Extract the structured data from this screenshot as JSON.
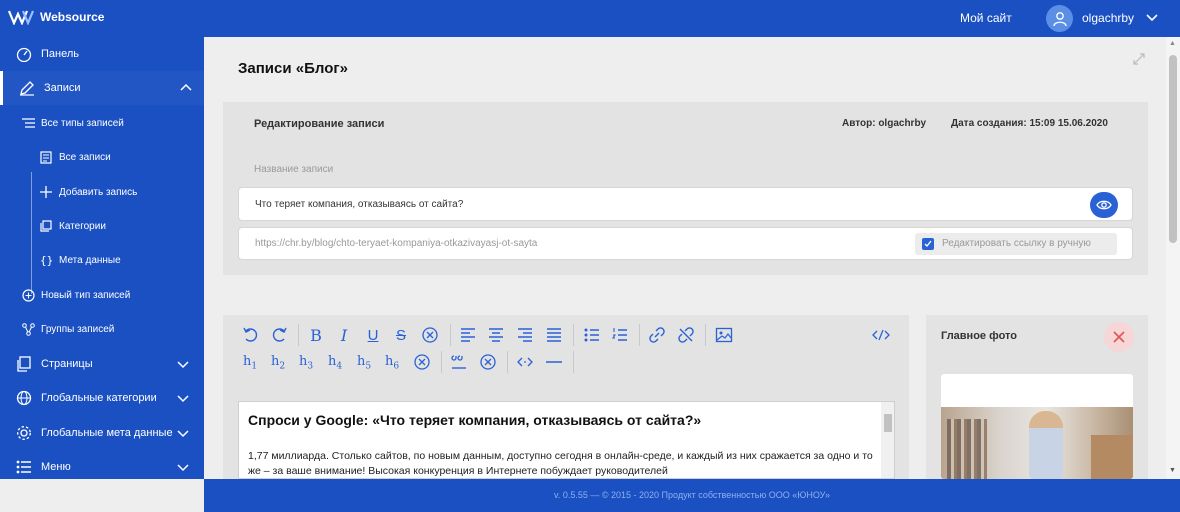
{
  "app": {
    "logo_text": "Websource",
    "brand_color": "#1a50c2",
    "accent_color": "#2a62d6"
  },
  "header": {
    "my_site": "Мой сайт",
    "username": "olgachrby"
  },
  "sidebar": {
    "items": [
      {
        "label": "Панель",
        "icon": "dashboard-icon"
      },
      {
        "label": "Записи",
        "icon": "pen-icon",
        "expanded": true
      },
      {
        "label": "Страницы",
        "icon": "pages-icon"
      },
      {
        "label": "Глобальные категории",
        "icon": "globe-icon"
      },
      {
        "label": "Глобальные мета данные",
        "icon": "gear-icon"
      },
      {
        "label": "Меню",
        "icon": "menu-icon"
      }
    ],
    "sub_items": [
      {
        "label": "Все типы записей",
        "icon": "list-icon"
      },
      {
        "label": "Все записи",
        "icon": "document-icon"
      },
      {
        "label": "Добавить запись",
        "icon": "plus-icon"
      },
      {
        "label": "Категории",
        "icon": "categories-icon"
      },
      {
        "label": "Мета данные",
        "icon": "braces-icon"
      },
      {
        "label": "Новый тип записей",
        "icon": "new-type-icon"
      },
      {
        "label": "Группы записей",
        "icon": "groups-icon"
      }
    ]
  },
  "page": {
    "title": "Записи «Блог»",
    "edit_heading": "Редактирование записи",
    "author": "Автор: olgachrby",
    "created": "Дата создания: 15:09 15.06.2020",
    "title_label": "Название записи",
    "title_value": "Что теряет компания, отказываясь от сайта?",
    "slug_value": "https://chr.by/blog/chto-teryaet-kompaniya-otkazivayasj-ot-sayta",
    "slug_edit_label": "Редактировать ссылку в ручную",
    "slug_edit_checked": true
  },
  "editor": {
    "heading": "Спроси у Google: «Что теряет компания, отказываясь от сайта?»",
    "paragraph": "1,77 миллиарда. Столько сайтов, по новым данным, доступно сегодня в онлайн-среде, и каждый из них сражается за одно и то же – за ваше внимание! Высокая конкуренция в Интернете побуждает руководителей",
    "headings": [
      "h1",
      "h2",
      "h3",
      "h4",
      "h5",
      "h6"
    ]
  },
  "photo": {
    "title": "Главное фото"
  },
  "footer": {
    "text": "v. 0.5.55 — © 2015 - 2020 Продукт собственностью ООО «ЮНОУ»"
  }
}
